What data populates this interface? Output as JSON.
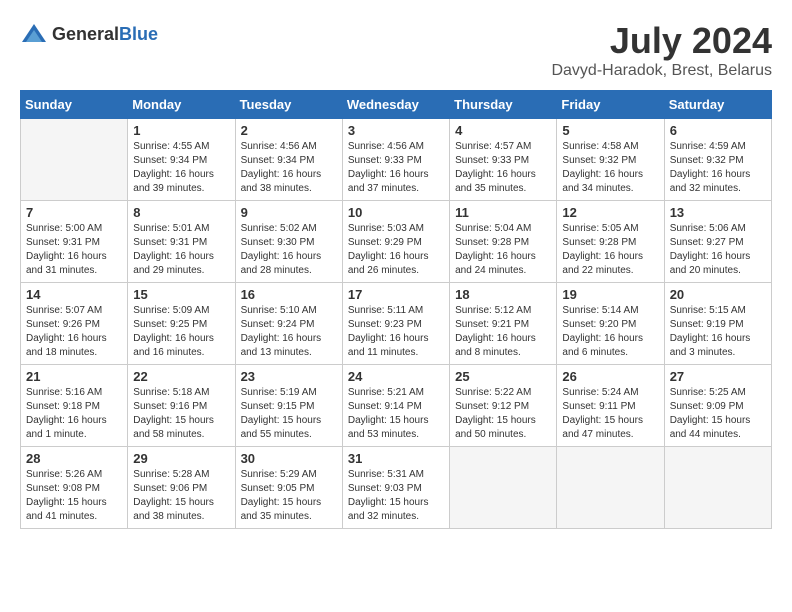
{
  "header": {
    "logo": {
      "general": "General",
      "blue": "Blue"
    },
    "title": "July 2024",
    "location": "Davyd-Haradok, Brest, Belarus"
  },
  "calendar": {
    "weekdays": [
      "Sunday",
      "Monday",
      "Tuesday",
      "Wednesday",
      "Thursday",
      "Friday",
      "Saturday"
    ],
    "weeks": [
      [
        {
          "day": "",
          "empty": true
        },
        {
          "day": "1",
          "sunrise": "Sunrise: 4:55 AM",
          "sunset": "Sunset: 9:34 PM",
          "daylight": "Daylight: 16 hours and 39 minutes."
        },
        {
          "day": "2",
          "sunrise": "Sunrise: 4:56 AM",
          "sunset": "Sunset: 9:34 PM",
          "daylight": "Daylight: 16 hours and 38 minutes."
        },
        {
          "day": "3",
          "sunrise": "Sunrise: 4:56 AM",
          "sunset": "Sunset: 9:33 PM",
          "daylight": "Daylight: 16 hours and 37 minutes."
        },
        {
          "day": "4",
          "sunrise": "Sunrise: 4:57 AM",
          "sunset": "Sunset: 9:33 PM",
          "daylight": "Daylight: 16 hours and 35 minutes."
        },
        {
          "day": "5",
          "sunrise": "Sunrise: 4:58 AM",
          "sunset": "Sunset: 9:32 PM",
          "daylight": "Daylight: 16 hours and 34 minutes."
        },
        {
          "day": "6",
          "sunrise": "Sunrise: 4:59 AM",
          "sunset": "Sunset: 9:32 PM",
          "daylight": "Daylight: 16 hours and 32 minutes."
        }
      ],
      [
        {
          "day": "7",
          "sunrise": "Sunrise: 5:00 AM",
          "sunset": "Sunset: 9:31 PM",
          "daylight": "Daylight: 16 hours and 31 minutes."
        },
        {
          "day": "8",
          "sunrise": "Sunrise: 5:01 AM",
          "sunset": "Sunset: 9:31 PM",
          "daylight": "Daylight: 16 hours and 29 minutes."
        },
        {
          "day": "9",
          "sunrise": "Sunrise: 5:02 AM",
          "sunset": "Sunset: 9:30 PM",
          "daylight": "Daylight: 16 hours and 28 minutes."
        },
        {
          "day": "10",
          "sunrise": "Sunrise: 5:03 AM",
          "sunset": "Sunset: 9:29 PM",
          "daylight": "Daylight: 16 hours and 26 minutes."
        },
        {
          "day": "11",
          "sunrise": "Sunrise: 5:04 AM",
          "sunset": "Sunset: 9:28 PM",
          "daylight": "Daylight: 16 hours and 24 minutes."
        },
        {
          "day": "12",
          "sunrise": "Sunrise: 5:05 AM",
          "sunset": "Sunset: 9:28 PM",
          "daylight": "Daylight: 16 hours and 22 minutes."
        },
        {
          "day": "13",
          "sunrise": "Sunrise: 5:06 AM",
          "sunset": "Sunset: 9:27 PM",
          "daylight": "Daylight: 16 hours and 20 minutes."
        }
      ],
      [
        {
          "day": "14",
          "sunrise": "Sunrise: 5:07 AM",
          "sunset": "Sunset: 9:26 PM",
          "daylight": "Daylight: 16 hours and 18 minutes."
        },
        {
          "day": "15",
          "sunrise": "Sunrise: 5:09 AM",
          "sunset": "Sunset: 9:25 PM",
          "daylight": "Daylight: 16 hours and 16 minutes."
        },
        {
          "day": "16",
          "sunrise": "Sunrise: 5:10 AM",
          "sunset": "Sunset: 9:24 PM",
          "daylight": "Daylight: 16 hours and 13 minutes."
        },
        {
          "day": "17",
          "sunrise": "Sunrise: 5:11 AM",
          "sunset": "Sunset: 9:23 PM",
          "daylight": "Daylight: 16 hours and 11 minutes."
        },
        {
          "day": "18",
          "sunrise": "Sunrise: 5:12 AM",
          "sunset": "Sunset: 9:21 PM",
          "daylight": "Daylight: 16 hours and 8 minutes."
        },
        {
          "day": "19",
          "sunrise": "Sunrise: 5:14 AM",
          "sunset": "Sunset: 9:20 PM",
          "daylight": "Daylight: 16 hours and 6 minutes."
        },
        {
          "day": "20",
          "sunrise": "Sunrise: 5:15 AM",
          "sunset": "Sunset: 9:19 PM",
          "daylight": "Daylight: 16 hours and 3 minutes."
        }
      ],
      [
        {
          "day": "21",
          "sunrise": "Sunrise: 5:16 AM",
          "sunset": "Sunset: 9:18 PM",
          "daylight": "Daylight: 16 hours and 1 minute."
        },
        {
          "day": "22",
          "sunrise": "Sunrise: 5:18 AM",
          "sunset": "Sunset: 9:16 PM",
          "daylight": "Daylight: 15 hours and 58 minutes."
        },
        {
          "day": "23",
          "sunrise": "Sunrise: 5:19 AM",
          "sunset": "Sunset: 9:15 PM",
          "daylight": "Daylight: 15 hours and 55 minutes."
        },
        {
          "day": "24",
          "sunrise": "Sunrise: 5:21 AM",
          "sunset": "Sunset: 9:14 PM",
          "daylight": "Daylight: 15 hours and 53 minutes."
        },
        {
          "day": "25",
          "sunrise": "Sunrise: 5:22 AM",
          "sunset": "Sunset: 9:12 PM",
          "daylight": "Daylight: 15 hours and 50 minutes."
        },
        {
          "day": "26",
          "sunrise": "Sunrise: 5:24 AM",
          "sunset": "Sunset: 9:11 PM",
          "daylight": "Daylight: 15 hours and 47 minutes."
        },
        {
          "day": "27",
          "sunrise": "Sunrise: 5:25 AM",
          "sunset": "Sunset: 9:09 PM",
          "daylight": "Daylight: 15 hours and 44 minutes."
        }
      ],
      [
        {
          "day": "28",
          "sunrise": "Sunrise: 5:26 AM",
          "sunset": "Sunset: 9:08 PM",
          "daylight": "Daylight: 15 hours and 41 minutes."
        },
        {
          "day": "29",
          "sunrise": "Sunrise: 5:28 AM",
          "sunset": "Sunset: 9:06 PM",
          "daylight": "Daylight: 15 hours and 38 minutes."
        },
        {
          "day": "30",
          "sunrise": "Sunrise: 5:29 AM",
          "sunset": "Sunset: 9:05 PM",
          "daylight": "Daylight: 15 hours and 35 minutes."
        },
        {
          "day": "31",
          "sunrise": "Sunrise: 5:31 AM",
          "sunset": "Sunset: 9:03 PM",
          "daylight": "Daylight: 15 hours and 32 minutes."
        },
        {
          "day": "",
          "empty": true
        },
        {
          "day": "",
          "empty": true
        },
        {
          "day": "",
          "empty": true
        }
      ]
    ]
  }
}
